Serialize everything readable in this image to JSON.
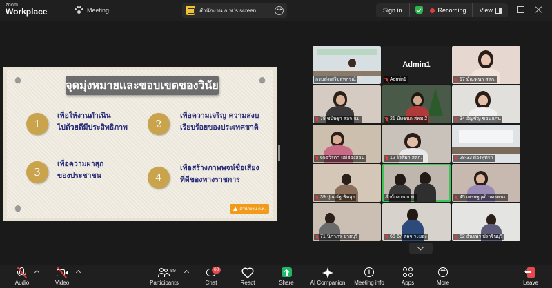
{
  "topbar": {
    "logo_top": "zoom",
    "logo_bottom": "Workplace",
    "meeting_tab": "Meeting",
    "screen_tab": "สำนักงาน ก.พ.'s screen",
    "signin": "Sign in",
    "recording": "Recording",
    "view": "View"
  },
  "slide": {
    "title": "จุดมุ่งหมายและขอบเขตของวินัย",
    "goals": [
      {
        "num": "1",
        "line1": "เพื่อให้งานดำเนิน",
        "line2": "ไปด้วยดีมีประสิทธิภาพ"
      },
      {
        "num": "2",
        "line1": "เพื่อความเจริญ ความสงบ",
        "line2": "เรียบร้อยของประเทศชาติ"
      },
      {
        "num": "3",
        "line1": "เพื่อความผาสุก",
        "line2": "ของประชาชน"
      },
      {
        "num": "4",
        "line1": "เพื่อสร้างภาพพจน์ชื่อเสียง",
        "line2": "ที่ดีของทางราชการ"
      }
    ],
    "badge": "สำนักงาน ก.พ."
  },
  "gallery": {
    "admin_tile_name": "Admin1",
    "participants": [
      "กรมส่งเสริมสหกรณ์",
      "Admin1",
      "17 มัณฑนา สลก.",
      "78 ชนิษฐา สลจ.ฉม",
      "21 นัทชนก สพม.2",
      "34 อัญชัญ ขอนแก่น",
      "65อวิรดา แม่ฮ่องสอน",
      "12 รังสิมา สลก.",
      "28-33 ผ่องพุทรา",
      "39 ปุณณัฐ พัทลุง",
      "สำนักงาน ก.พ.",
      "45 เศรษฐวุฒิ นครพนม",
      "71 นิภาภร ชายบุรี",
      "66-67 สลจ.ระยอง",
      "52 ธันยพร ปราจีนบุรี"
    ]
  },
  "toolbar": {
    "audio": "Audio",
    "video": "Video",
    "participants": "Participants",
    "participants_count": "89",
    "chat": "Chat",
    "chat_badge": "60",
    "react": "React",
    "share": "Share",
    "ai_companion": "AI Companion",
    "meeting_info": "Meeting info",
    "apps": "Apps",
    "more": "More",
    "leave": "Leave"
  },
  "colors": {
    "recording_dot": "#e23c3c",
    "share_green": "#1fb86b",
    "active_speaker": "#3ec35a",
    "slide_text": "#2a2f7a",
    "goal_circle": "#c9a44c"
  }
}
